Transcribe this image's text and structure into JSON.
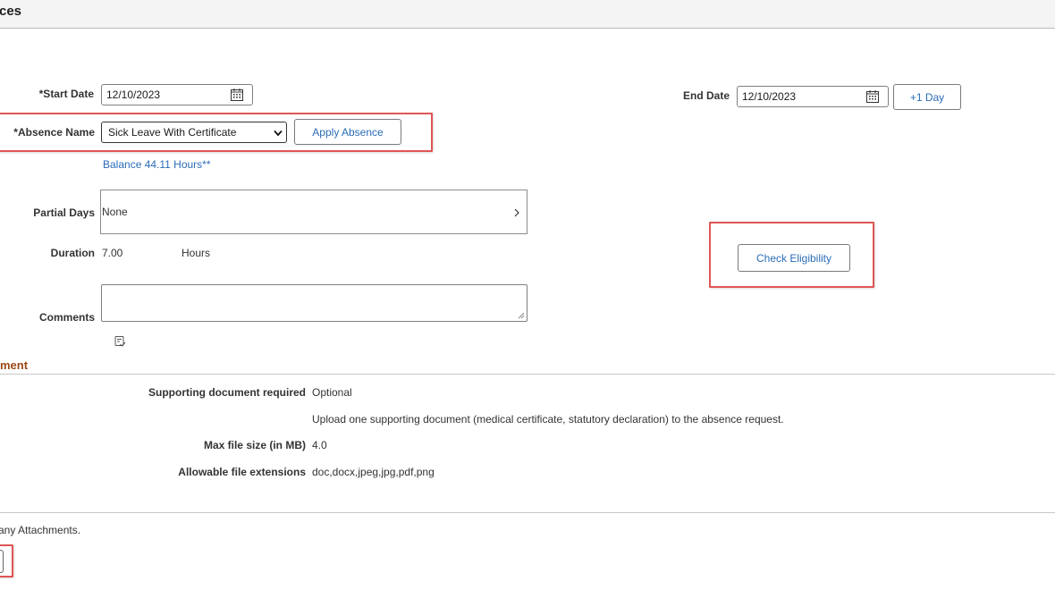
{
  "header": {
    "title": "ces"
  },
  "form": {
    "start_date_label": "*Start Date",
    "start_date_value": "12/10/2023",
    "end_date_label": "End Date",
    "end_date_value": "12/10/2023",
    "plus_one_day_label": "+1 Day",
    "absence_name_label": "*Absence Name",
    "absence_name_value": "Sick Leave With Certificate",
    "apply_absence_label": "Apply Absence",
    "balance_text": "Balance  44.11 Hours**",
    "partial_days_label": "Partial Days",
    "partial_days_value": "None",
    "duration_label": "Duration",
    "duration_value": "7.00",
    "duration_unit": "Hours",
    "check_eligibility_label": "Check Eligibility",
    "comments_label": "Comments"
  },
  "attachment_section": {
    "title": "ment",
    "rows": [
      {
        "label": "Supporting document required",
        "value": "Optional"
      },
      {
        "label": "",
        "value": "Upload one supporting document (medical certificate, statutory declaration) to the absence request."
      },
      {
        "label": "Max file size (in MB)",
        "value": "4.0"
      },
      {
        "label": "Allowable file extensions",
        "value": "doc,docx,jpeg,jpg,pdf,png"
      }
    ]
  },
  "footer": {
    "note": "any Attachments."
  },
  "icons": {
    "calendar": "calendar-icon",
    "chevron": "chevron-right-icon",
    "spellcheck": "spellcheck-icon"
  },
  "colors": {
    "highlight": "#e05555",
    "link": "#2b6cb8",
    "section_title": "#9a4a17"
  }
}
